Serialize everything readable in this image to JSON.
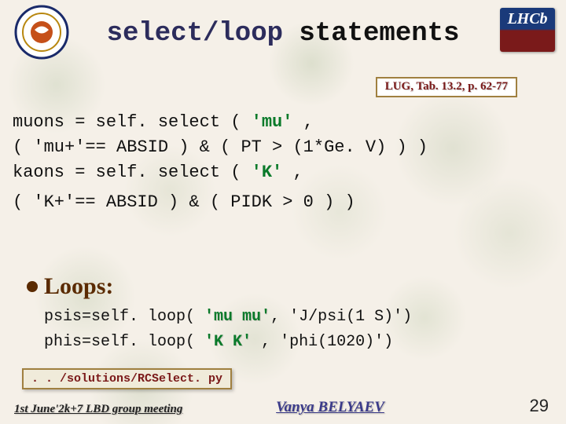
{
  "title": {
    "mono_part": "select/loop",
    "rest": " statements"
  },
  "ref_badge": "LUG, Tab. 13.2, p. 62-77",
  "code": {
    "l1_a": "muons = self. select ( ",
    "l1_b": "'mu'",
    "l1_c": " ,",
    "l2": "        ( 'mu+'== ABSID ) & ( PT > (1*Ge. V) ) )",
    "l3_a": "kaons = self. select ( ",
    "l3_b": "'K'",
    "l3_c": "  ,",
    "l4": "        ( 'K+'== ABSID ) & ( PIDK > 0 )   )"
  },
  "loops": {
    "heading": "Loops:",
    "l1_a": "psis=self. loop( ",
    "l1_b": "'mu mu'",
    "l1_c": ", 'J/psi(1 S)')",
    "l2_a": " phis=self. loop( ",
    "l2_b": "'K K'",
    "l2_c": " ,  'phi(1020)')"
  },
  "filebox": ". . /solutions/RCSelect. py",
  "footer": {
    "left": "1st June'2k+7  LBD group meeting",
    "center": "Vanya  BELYAEV",
    "page": "29"
  }
}
